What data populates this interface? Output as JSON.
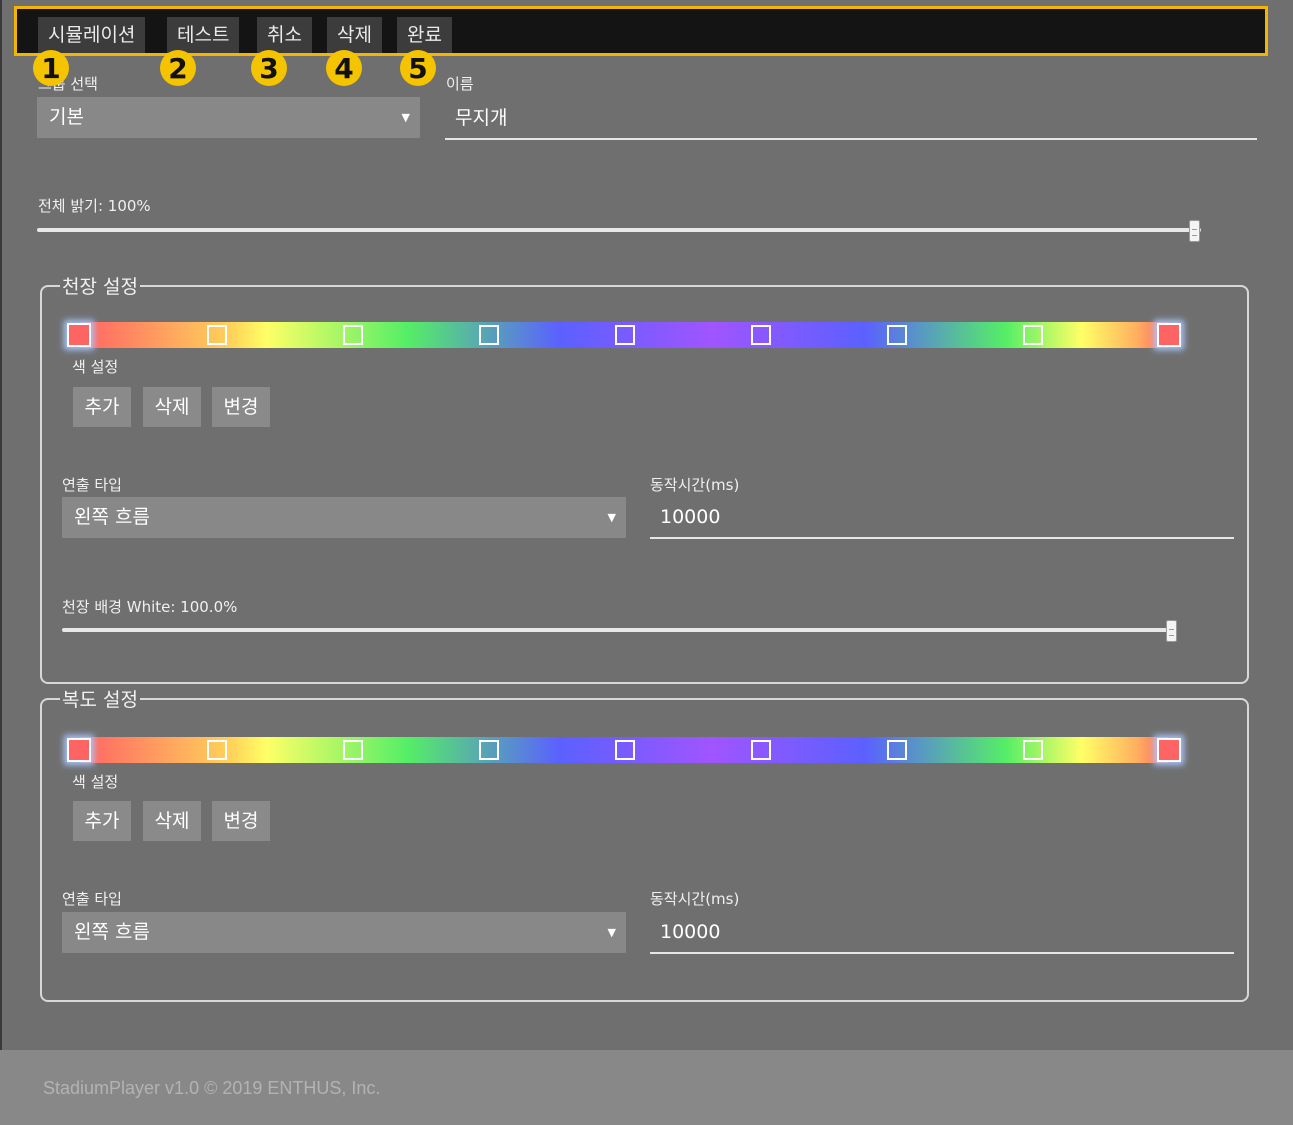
{
  "toolbar": {
    "buttons": [
      {
        "label": "시뮬레이션",
        "marker": "1"
      },
      {
        "label": "테스트",
        "marker": "2"
      },
      {
        "label": "취소",
        "marker": "3"
      },
      {
        "label": "삭제",
        "marker": "4"
      },
      {
        "label": "완료",
        "marker": "5"
      }
    ]
  },
  "group": {
    "label": "그룹 선택",
    "value": "기본"
  },
  "name": {
    "label": "이름",
    "value": "무지개"
  },
  "brightness": {
    "label": "전체 밝기: 100%",
    "value": 1.0
  },
  "ceiling": {
    "title": "천장 설정",
    "color_label": "색 설정",
    "buttons": [
      "추가",
      "삭제",
      "변경"
    ],
    "effect_label": "연출 타입",
    "effect_value": "왼쪽 흐름",
    "duration_label": "동작시간(ms)",
    "duration_value": "10000",
    "background_label": "천장 배경 White: 100.0%",
    "background_value": 1.0,
    "stops": [
      "#ff6464",
      "#ffff66",
      "#55ee66",
      "#6464ff",
      "#b05aff",
      "#6464ff",
      "#55ee66",
      "#ffff66",
      "#ff6464"
    ]
  },
  "corridor": {
    "title": "복도 설정",
    "color_label": "색 설정",
    "buttons": [
      "추가",
      "삭제",
      "변경"
    ],
    "effect_label": "연출 타입",
    "effect_value": "왼쪽 흐름",
    "duration_label": "동작시간(ms)",
    "duration_value": "10000",
    "stops": [
      "#ff6464",
      "#ffff66",
      "#55ee66",
      "#6464ff",
      "#b05aff",
      "#6464ff",
      "#55ee66",
      "#ffff66",
      "#ff6464"
    ]
  },
  "footer": {
    "text": "StadiumPlayer v1.0 © 2019 ENTHUS, Inc."
  }
}
